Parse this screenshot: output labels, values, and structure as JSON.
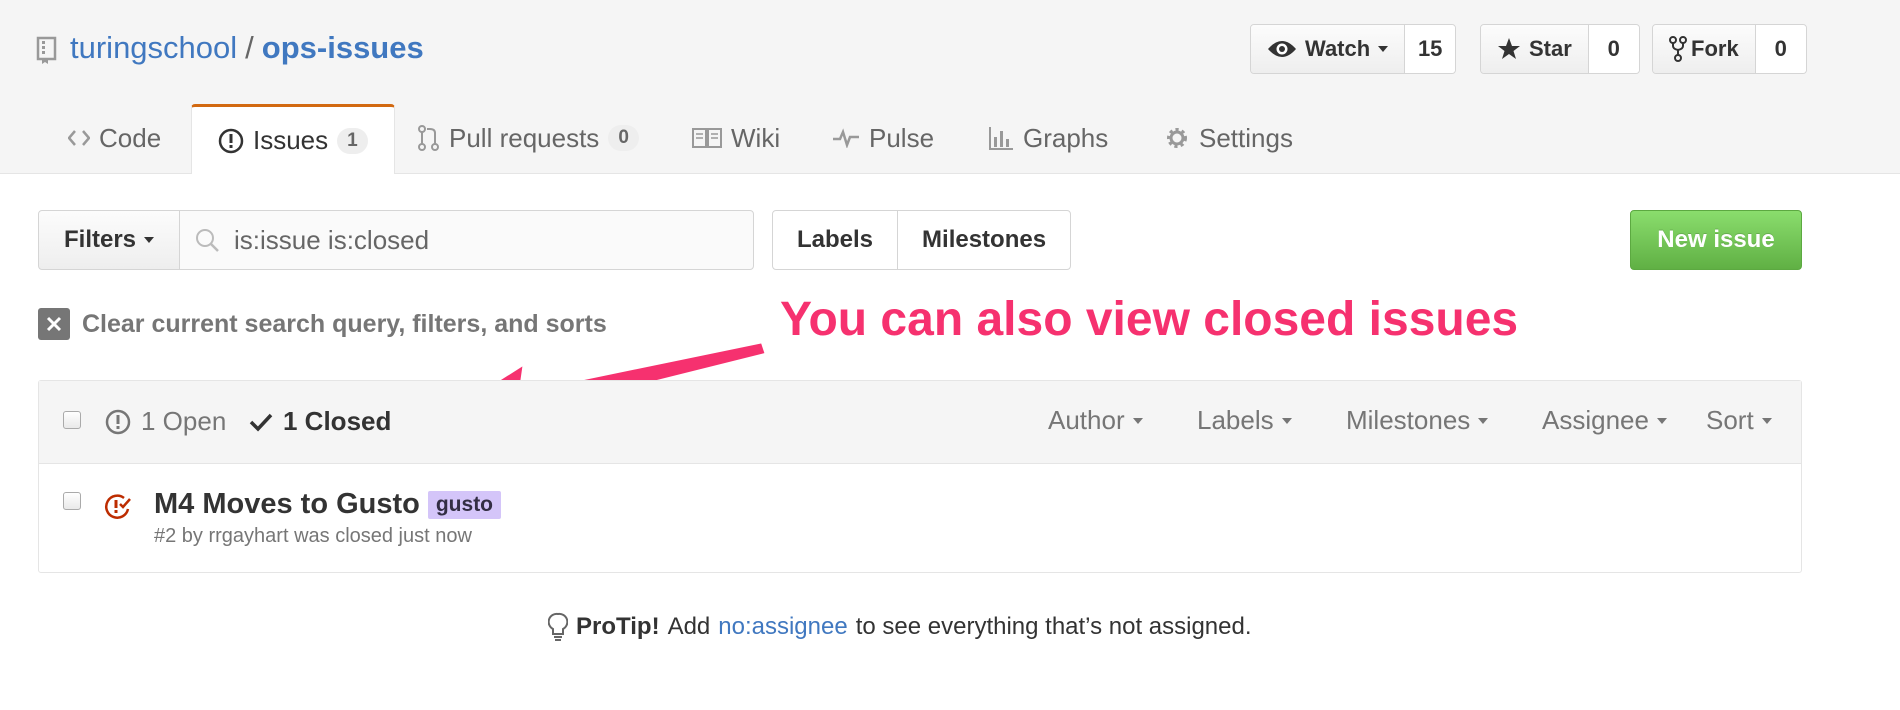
{
  "repo": {
    "owner": "turingschool",
    "separator": "/",
    "name": "ops-issues"
  },
  "actions": {
    "watch": {
      "label": "Watch",
      "count": "15"
    },
    "star": {
      "label": "Star",
      "count": "0"
    },
    "fork": {
      "label": "Fork",
      "count": "0"
    }
  },
  "tabs": [
    {
      "label": "Code"
    },
    {
      "label": "Issues",
      "counter": "1",
      "selected": true
    },
    {
      "label": "Pull requests",
      "counter": "0"
    },
    {
      "label": "Wiki"
    },
    {
      "label": "Pulse"
    },
    {
      "label": "Graphs"
    },
    {
      "label": "Settings"
    }
  ],
  "filter_bar": {
    "filters_label": "Filters",
    "search_value": "is:issue is:closed",
    "labels_label": "Labels",
    "milestones_label": "Milestones",
    "new_issue_label": "New issue"
  },
  "clear_query": {
    "label": "Clear current search query, filters, and sorts"
  },
  "annotation": {
    "text": "You can also view closed issues",
    "color": "#f6316f"
  },
  "issues_header": {
    "open_label": "1 Open",
    "closed_label": "1 Closed",
    "sort_menus": [
      "Author",
      "Labels",
      "Milestones",
      "Assignee",
      "Sort"
    ]
  },
  "issues": [
    {
      "title": "M4 Moves to Gusto",
      "label": "gusto",
      "label_color": "#d4c5f9",
      "meta": "#2 by rrgayhart was closed just now"
    }
  ],
  "protip": {
    "prefix": "ProTip!",
    "text_before": "Add",
    "link": "no:assignee",
    "text_after": "to see everything that’s not assigned."
  },
  "colors": {
    "link": "#4078c0",
    "accent_tab": "#d26911",
    "new_issue": "#60b044",
    "closed_icon": "#bd2c00"
  }
}
